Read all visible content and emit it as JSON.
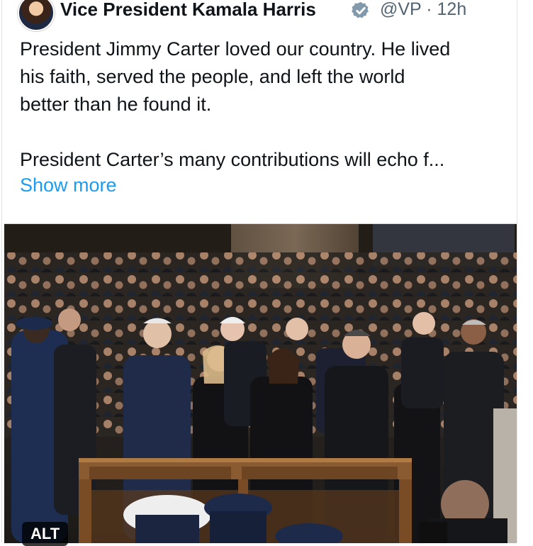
{
  "post": {
    "author_name": "Vice President Kamala Harris",
    "author_handle": "@VP",
    "separator": "·",
    "time_ago": "12h",
    "text": "President Jimmy Carter loved our country. He lived\nhis faith, served the people, and left the world\nbetter than he found it.\n\nPresident Carter’s many contributions will echo f...",
    "show_more_label": "Show more",
    "alt_badge_label": "ALT"
  },
  "icons": {
    "avatar": "profile-avatar",
    "verified": "gray-verified-badge-icon"
  },
  "colors": {
    "text_primary": "#0f1419",
    "text_secondary": "#536471",
    "link": "#1d9bf0",
    "verified_badge": "#829aab"
  }
}
